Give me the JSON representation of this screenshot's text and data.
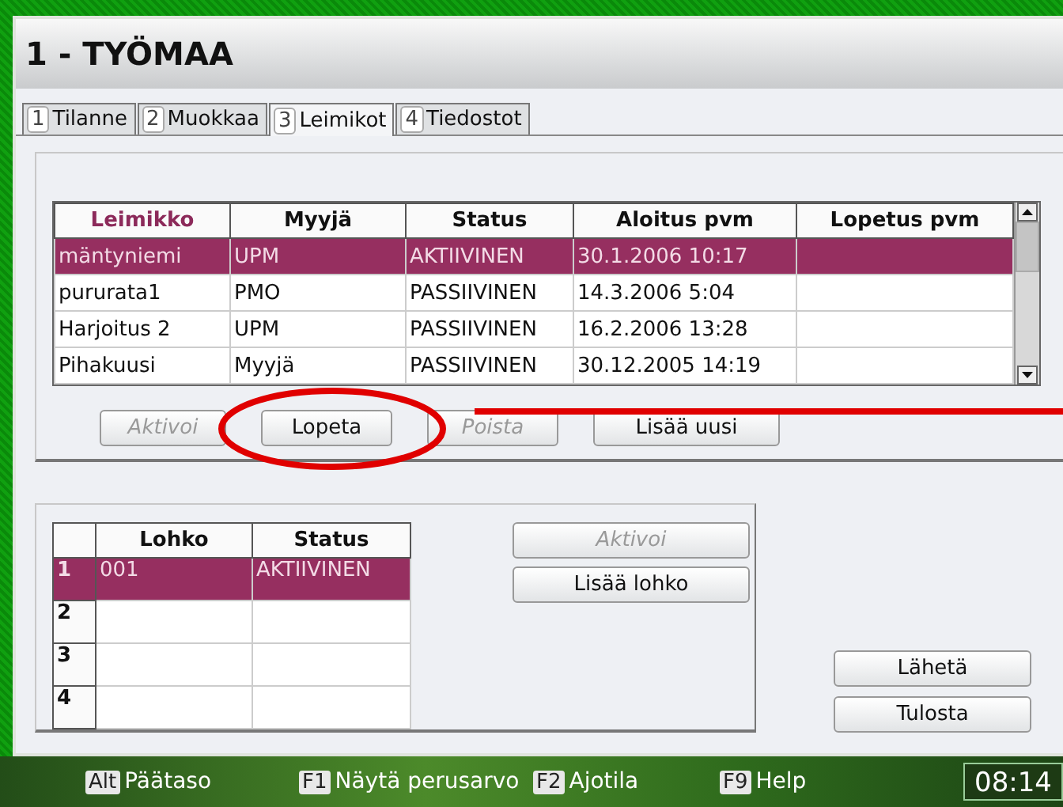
{
  "window": {
    "title": "1 - TYÖMAA"
  },
  "tabs": [
    {
      "number": "1",
      "label": "Tilanne",
      "selected": false
    },
    {
      "number": "2",
      "label": "Muokkaa",
      "selected": false
    },
    {
      "number": "3",
      "label": "Leimikot",
      "selected": true
    },
    {
      "number": "4",
      "label": "Tiedostot",
      "selected": false
    }
  ],
  "leimikot": {
    "columns": [
      {
        "label": "Leimikko",
        "sorted": true
      },
      {
        "label": "Myyjä",
        "sorted": false
      },
      {
        "label": "Status",
        "sorted": false
      },
      {
        "label": "Aloitus pvm",
        "sorted": false
      },
      {
        "label": "Lopetus pvm",
        "sorted": false
      }
    ],
    "rows": [
      {
        "cells": [
          "mäntyniemi",
          "UPM",
          "AKTIIVINEN",
          "30.1.2006 10:17",
          ""
        ],
        "selected": true
      },
      {
        "cells": [
          "pururata1",
          "PMO",
          "PASSIIVINEN",
          "14.3.2006 5:04",
          ""
        ],
        "selected": false
      },
      {
        "cells": [
          "Harjoitus 2",
          "UPM",
          "PASSIIVINEN",
          "16.2.2006 13:28",
          ""
        ],
        "selected": false
      },
      {
        "cells": [
          "Pihakuusi",
          "Myyjä",
          "PASSIIVINEN",
          "30.12.2005 14:19",
          ""
        ],
        "selected": false
      }
    ],
    "buttons": [
      {
        "label": "Aktivoi",
        "disabled": true
      },
      {
        "label": "Lopeta",
        "disabled": false
      },
      {
        "label": "Poista",
        "disabled": true
      },
      {
        "label": "Lisää uusi",
        "disabled": false
      }
    ]
  },
  "lohkot": {
    "columns": [
      "Lohko",
      "Status"
    ],
    "rows": [
      {
        "number": "1",
        "cells": [
          "001",
          "AKTIIVINEN"
        ],
        "selected": true
      },
      {
        "number": "2",
        "cells": [
          "",
          ""
        ],
        "selected": false
      },
      {
        "number": "3",
        "cells": [
          "",
          ""
        ],
        "selected": false
      },
      {
        "number": "4",
        "cells": [
          "",
          ""
        ],
        "selected": false
      }
    ],
    "buttons": [
      {
        "label": "Aktivoi",
        "disabled": true
      },
      {
        "label": "Lisää lohko",
        "disabled": false
      }
    ]
  },
  "side_buttons": [
    {
      "label": "Lähetä",
      "disabled": false
    },
    {
      "label": "Tulosta",
      "disabled": false
    }
  ],
  "status_bar": {
    "keys": [
      {
        "key": "Alt",
        "label": "Päätaso"
      },
      {
        "key": "F1",
        "label": "Näytä perusarvo"
      },
      {
        "key": "F2",
        "label": "Ajotila"
      },
      {
        "key": "F9",
        "label": "Help"
      }
    ],
    "clock": "08:14"
  }
}
